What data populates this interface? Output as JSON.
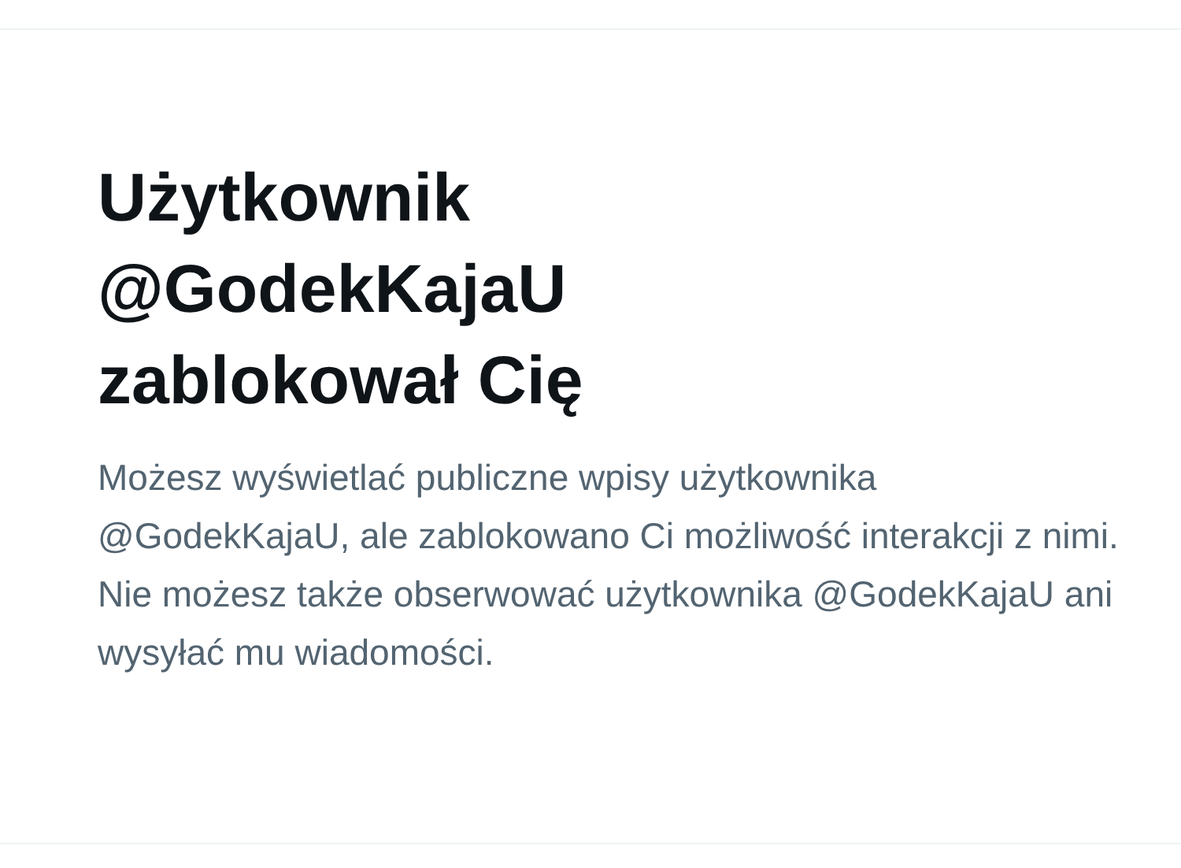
{
  "block_notice": {
    "title": "Użytkownik @GodekKajaU zablokował Cię",
    "description": "Możesz wyświetlać publiczne wpisy użytkownika @GodekKajaU, ale zablokowano Ci możliwość interakcji z nimi. Nie możesz także obserwować użytkownika @GodekKajaU ani wysyłać mu wiadomości."
  }
}
